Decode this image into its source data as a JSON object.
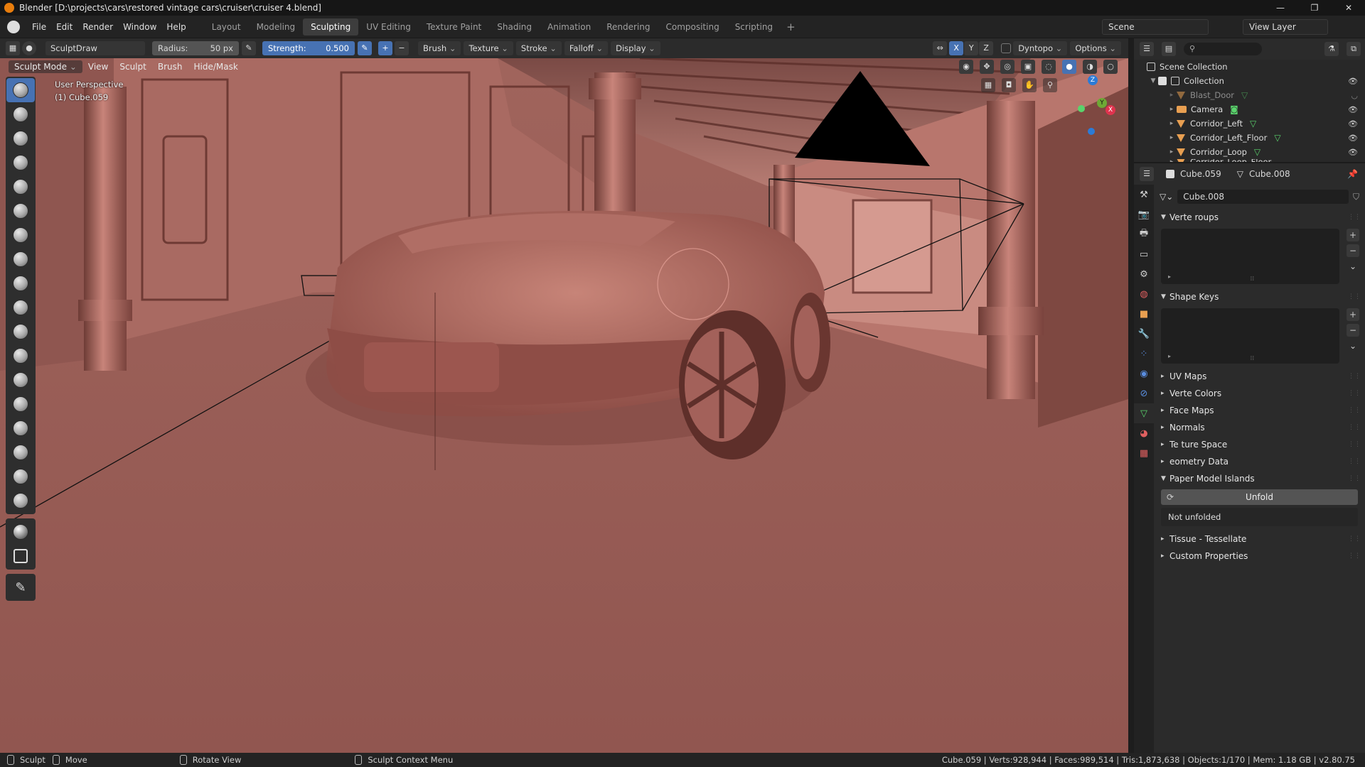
{
  "window": {
    "title": "Blender [D:\\projects\\cars\\restored vintage cars\\cruiser\\cruiser 4.blend]",
    "minimize": "—",
    "maximize": "❐",
    "close": "✕"
  },
  "menu": [
    "File",
    "Edit",
    "Render",
    "Window",
    "Help"
  ],
  "workspaces": [
    "Layout",
    "Modeling",
    "Sculpting",
    "UV Editing",
    "Texture Paint",
    "Shading",
    "Animation",
    "Rendering",
    "Compositing",
    "Scripting"
  ],
  "active_workspace": "Sculpting",
  "add_workspace": "+",
  "scene_name": "Scene",
  "view_layer": "View Layer",
  "tool_header": {
    "brush_name": "SculptDraw",
    "radius_label": "Radius:",
    "radius_value": "50 px",
    "strength_label": "Strength:",
    "strength_value": "0.500",
    "plus": "+",
    "minus": "−",
    "menus": [
      "Brush",
      "Texture",
      "Stroke",
      "Falloff",
      "Display"
    ],
    "axes": [
      "X",
      "Y",
      "Z"
    ],
    "dyntopo": "Dyntopo",
    "options": "Options"
  },
  "viewport_header": {
    "mode": "Sculpt Mode",
    "menus": [
      "View",
      "Sculpt",
      "Brush",
      "Hide/Mask"
    ]
  },
  "viewport_overlay": {
    "perspective": "User Perspective",
    "object": "(1) Cube.059"
  },
  "gizmo": {
    "x": "X",
    "y": "Y",
    "z": "Z"
  },
  "outliner": {
    "root": "Scene Collection",
    "collection": "Collection",
    "items": [
      "Blast_Door",
      "Camera",
      "Corridor_Left",
      "Corridor_Left_Floor",
      "Corridor_Loop",
      "Corridor_Loop_Floor"
    ]
  },
  "properties": {
    "object_name": "Cube.059",
    "data_name": "Cube.008",
    "mesh_field": "Cube.008",
    "panels": {
      "vertex_groups": "Verte   roups",
      "shape_keys": "Shape Keys",
      "uv_maps": "UV Maps",
      "vertex_colors": "Verte  Colors",
      "face_maps": "Face Maps",
      "normals": "Normals",
      "texture_space": "Te  ture Space",
      "geometry_data": " eometry Data",
      "paper_model": "Paper Model Islands",
      "unfold_button": "Unfold",
      "unfold_status": "Not unfolded",
      "tissue": "Tissue - Tessellate",
      "custom_props": "Custom Properties"
    }
  },
  "statusbar": {
    "left1": "Sculpt",
    "left2": "Move",
    "left3": "Rotate View",
    "left4": "Sculpt Context Menu",
    "stats": "Cube.059 | Verts:928,944 | Faces:989,514 | Tris:1,873,638 | Objects:1/170 | Mem: 1.18 GB | v2.80.75"
  },
  "colors": {
    "accent": "#4772b3",
    "viewport_clay": "#9a5c55",
    "object_orange": "#e89f51",
    "mesh_data_green": "#5ad36c"
  }
}
